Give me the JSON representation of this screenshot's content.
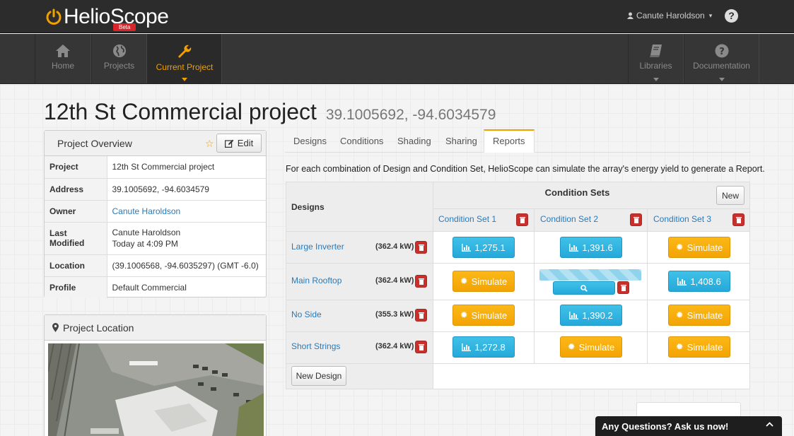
{
  "brand": {
    "name": "HelioScope",
    "badge": "Beta"
  },
  "user": {
    "name": "Canute Haroldson"
  },
  "nav": {
    "left": [
      {
        "label": "Home",
        "icon": "home-icon"
      },
      {
        "label": "Projects",
        "icon": "globe-icon"
      },
      {
        "label": "Current Project",
        "icon": "wrench-icon",
        "active": true
      }
    ],
    "right": [
      {
        "label": "Libraries",
        "icon": "book-icon"
      },
      {
        "label": "Documentation",
        "icon": "question-icon"
      }
    ]
  },
  "project": {
    "title": "12th St Commercial project",
    "coords": "39.1005692, -94.6034579"
  },
  "overview": {
    "title": "Project Overview",
    "edit_label": "Edit",
    "rows": [
      {
        "key": "Project",
        "value": "12th St Commercial project"
      },
      {
        "key": "Address",
        "value": "39.1005692, -94.6034579"
      },
      {
        "key": "Owner",
        "value": "Canute Haroldson"
      },
      {
        "key": "Last Modified",
        "value": "Canute Haroldson",
        "value2": "Today at 4:09 PM"
      },
      {
        "key": "Location",
        "value": "(39.1006568, -94.6035297) (GMT -6.0)"
      },
      {
        "key": "Profile",
        "value": "Default Commercial"
      }
    ]
  },
  "location_panel": {
    "title": "Project Location"
  },
  "tabs": [
    "Designs",
    "Conditions",
    "Shading",
    "Sharing",
    "Reports"
  ],
  "active_tab": "Reports",
  "reports": {
    "intro": "For each combination of Design and Condition Set, HelioScope can simulate the array's energy yield to generate a Report.",
    "designs_header": "Designs",
    "condition_sets_header": "Condition Sets",
    "new_label": "New",
    "new_design_label": "New Design",
    "condition_sets": [
      "Condition Set 1",
      "Condition Set 2",
      "Condition Set 3"
    ],
    "rows": [
      {
        "name": "Large Inverter",
        "kw": "(362.4 kW)",
        "cells": [
          {
            "type": "result",
            "label": "1,275.1"
          },
          {
            "type": "result",
            "label": "1,391.6"
          },
          {
            "type": "simulate",
            "label": "Simulate"
          }
        ]
      },
      {
        "name": "Main Rooftop",
        "kw": "(362.4 kW)",
        "cells": [
          {
            "type": "simulate",
            "label": "Simulate"
          },
          {
            "type": "running",
            "label": ""
          },
          {
            "type": "result",
            "label": "1,408.6"
          }
        ]
      },
      {
        "name": "No Side",
        "kw": "(355.3 kW)",
        "cells": [
          {
            "type": "simulate",
            "label": "Simulate"
          },
          {
            "type": "result",
            "label": "1,390.2"
          },
          {
            "type": "simulate",
            "label": "Simulate"
          }
        ]
      },
      {
        "name": "Short Strings",
        "kw": "(362.4 kW)",
        "cells": [
          {
            "type": "result",
            "label": "1,272.8"
          },
          {
            "type": "simulate",
            "label": "Simulate"
          },
          {
            "type": "simulate",
            "label": "Simulate"
          }
        ]
      }
    ]
  },
  "chat": {
    "label": "Any Questions? Ask us now!"
  },
  "colors": {
    "accent": "#f0a000",
    "blue_button": "#2eb3e0",
    "orange_button": "#f6a90b",
    "danger": "#c9302c",
    "link": "#2a7ab8"
  }
}
